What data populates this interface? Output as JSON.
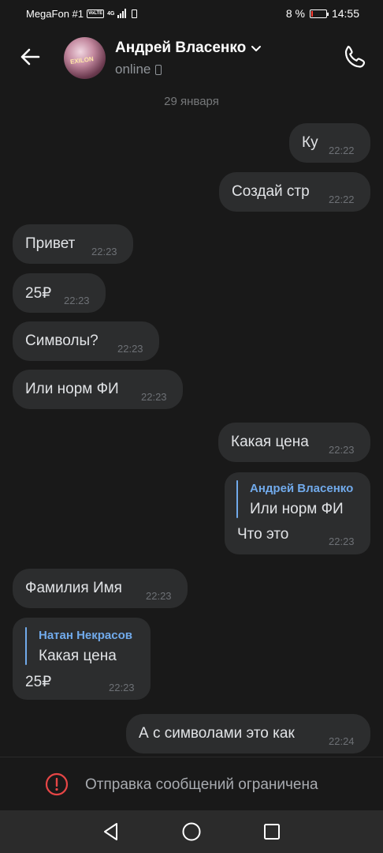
{
  "status_bar": {
    "carrier": "MegaFon #1",
    "volte": "VoLTE",
    "network": "4G",
    "battery_percent": "8 %",
    "battery_level": 0.08,
    "time": "14:55"
  },
  "header": {
    "contact_name": "Андрей Власенко",
    "status": "online",
    "avatar_tag": "EXILON"
  },
  "chat": {
    "date_separator": "29 января",
    "messages": [
      {
        "side": "out",
        "text": "Ку",
        "time": "22:22"
      },
      {
        "side": "out",
        "text": "Создай стр",
        "time": "22:22"
      },
      {
        "side": "in",
        "text": "Привет",
        "time": "22:23"
      },
      {
        "side": "in",
        "text": "25₽",
        "time": "22:23"
      },
      {
        "side": "in",
        "text": "Символы?",
        "time": "22:23"
      },
      {
        "side": "in",
        "text": "Или норм ФИ",
        "time": "22:23"
      },
      {
        "side": "out",
        "text": "Какая цена",
        "time": "22:23"
      },
      {
        "side": "out",
        "reply_name": "Андрей Власенко",
        "reply_text": "Или норм ФИ",
        "text": "Что это",
        "time": "22:23"
      },
      {
        "side": "in",
        "text": "Фамилия Имя",
        "time": "22:23"
      },
      {
        "side": "in",
        "reply_name": "Натан Некрасов",
        "reply_text": "Какая цена",
        "text": "25₽",
        "time": "22:23"
      },
      {
        "side": "out",
        "text": "А с символами это как",
        "time": "22:24"
      }
    ]
  },
  "composer": {
    "restricted_notice": "Отправка сообщений ограничена"
  },
  "colors": {
    "background": "#191919",
    "bubble": "#2c2d2e",
    "accent": "#71aaeb",
    "warning": "#e64646"
  }
}
